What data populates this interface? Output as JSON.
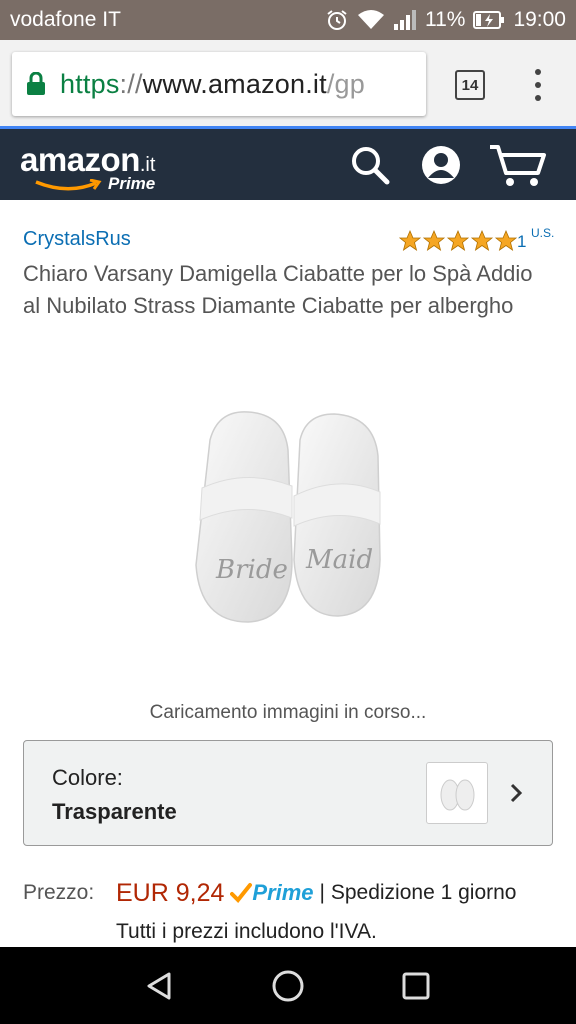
{
  "status_bar": {
    "carrier": "vodafone IT",
    "battery": "11%",
    "time": "19:00"
  },
  "browser": {
    "url_scheme": "https",
    "url_sep": "://",
    "url_host": "www.amazon.it",
    "url_path": "/gp",
    "tab_count": "14"
  },
  "nav": {
    "logo_word": "amazon",
    "logo_tld": ".it",
    "logo_prime": "Prime"
  },
  "product": {
    "brand": "CrystalsRus",
    "rating_stars": 5,
    "rating_count": "1",
    "rating_country": "U.S.",
    "title": "Chiaro Varsany Damigella Ciabatte per lo Spà Addio al Nubilato Strass Diamante Ciabatte per albergho",
    "loading_text": "Caricamento immagini in corso...",
    "color_label": "Colore:",
    "color_value": "Trasparente",
    "price_label": "Prezzo:",
    "price_value": "EUR 9,24",
    "prime_text": "Prime",
    "shipping_text": "| Spedizione 1 giorno",
    "vat_text": "Tutti i prezzi includono l'IVA."
  },
  "colors": {
    "status_bar": "#7a6d66",
    "nav_bg": "#232f3e",
    "link": "#0b6eb3",
    "price": "#b12704",
    "prime": "#1fa0d8",
    "star": "#f5a623"
  }
}
